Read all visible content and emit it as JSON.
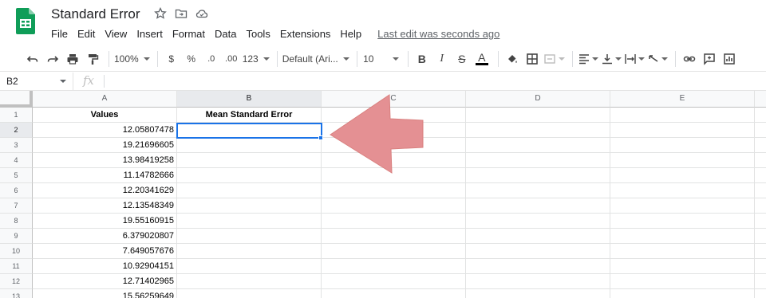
{
  "app": {
    "title": "Standard Error",
    "brand_color": "#0f9d58",
    "accent_color": "#1a73e8"
  },
  "menu": {
    "items": [
      "File",
      "Edit",
      "View",
      "Insert",
      "Format",
      "Data",
      "Tools",
      "Extensions",
      "Help"
    ],
    "last_edit": "Last edit was seconds ago"
  },
  "toolbar": {
    "zoom": "100%",
    "currency": "$",
    "percent": "%",
    "decrease_decimal": ".0",
    "increase_decimal": ".00",
    "more_formats": "123",
    "font": "Default (Ari...",
    "font_size": "10",
    "bold": "B",
    "italic": "I",
    "strikethrough": "S",
    "text_color": "A",
    "icons": [
      "undo-icon",
      "redo-icon",
      "print-icon",
      "paint-format-icon",
      "fill-color-icon",
      "borders-icon",
      "merge-cells-icon",
      "align-horizontal-icon",
      "align-vertical-icon",
      "text-wrap-icon",
      "text-rotate-icon",
      "link-icon",
      "comment-icon",
      "chart-icon"
    ]
  },
  "formula_bar": {
    "name_box": "B2",
    "fx": "fx",
    "value": ""
  },
  "columns": [
    "A",
    "B",
    "C",
    "D",
    "E"
  ],
  "rows": [
    "1",
    "2",
    "3",
    "4",
    "5",
    "6",
    "7",
    "8",
    "9",
    "10",
    "11",
    "12",
    "13"
  ],
  "cells": {
    "A1": "Values",
    "B1": "Mean Standard Error",
    "A_values": [
      "12.05807478",
      "19.21696605",
      "13.98419258",
      "11.14782666",
      "12.20341629",
      "12.13548349",
      "19.55160915",
      "6.379020807",
      "7.649057676",
      "10.92904151",
      "12.71402965",
      "15.56259649"
    ]
  },
  "selection": {
    "cell": "B2",
    "arrow_color": "#e49093"
  }
}
